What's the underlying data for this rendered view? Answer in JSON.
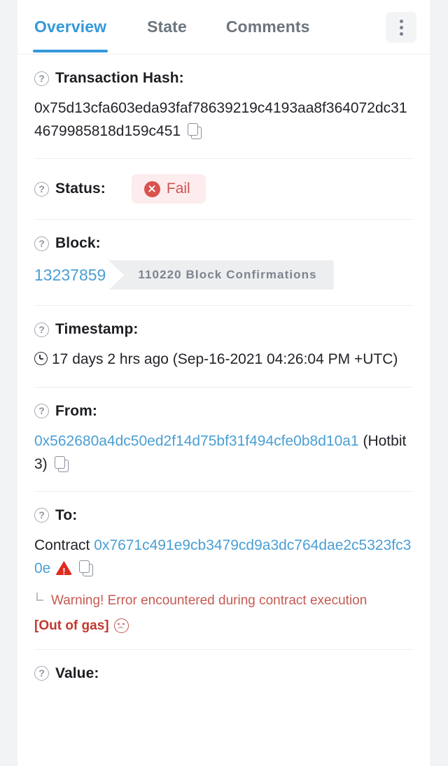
{
  "tabs": [
    {
      "label": "Overview",
      "active": true
    },
    {
      "label": "State",
      "active": false
    },
    {
      "label": "Comments",
      "active": false
    }
  ],
  "menu": {
    "icon": "kebab-menu-icon"
  },
  "rows": {
    "transaction_hash": {
      "label": "Transaction Hash:",
      "value": "0x75d13cfa603eda93faf78639219c4193aa8f364072dc314679985818d159c451"
    },
    "status": {
      "label": "Status:",
      "badge_text": "Fail",
      "badge_bg": "#fdeced",
      "badge_color": "#cf5350",
      "icon": "x-circle-icon"
    },
    "block": {
      "label": "Block:",
      "number": "13237859",
      "confirmations": "110220 Block Confirmations"
    },
    "timestamp": {
      "label": "Timestamp:",
      "value": "17 days 2 hrs ago (Sep-16-2021 04:26:04 PM +UTC)"
    },
    "from": {
      "label": "From:",
      "address": "0x562680a4dc50ed2f14d75bf31f494cfe0b8d10a1",
      "tag": "(Hotbit 3)"
    },
    "to": {
      "label": "To:",
      "prefix": "Contract",
      "address": "0x7671c491e9cb3479cd9a3dc764dae2c5323fc30e",
      "warning_line1": "Warning! Error encountered during contract execution",
      "warning_line2": "[Out of gas]"
    },
    "value": {
      "label": "Value:"
    }
  },
  "colors": {
    "accent": "#3498db",
    "link": "#4a9fd4",
    "danger": "#e02b20",
    "page_bg": "#f2f3f5"
  }
}
